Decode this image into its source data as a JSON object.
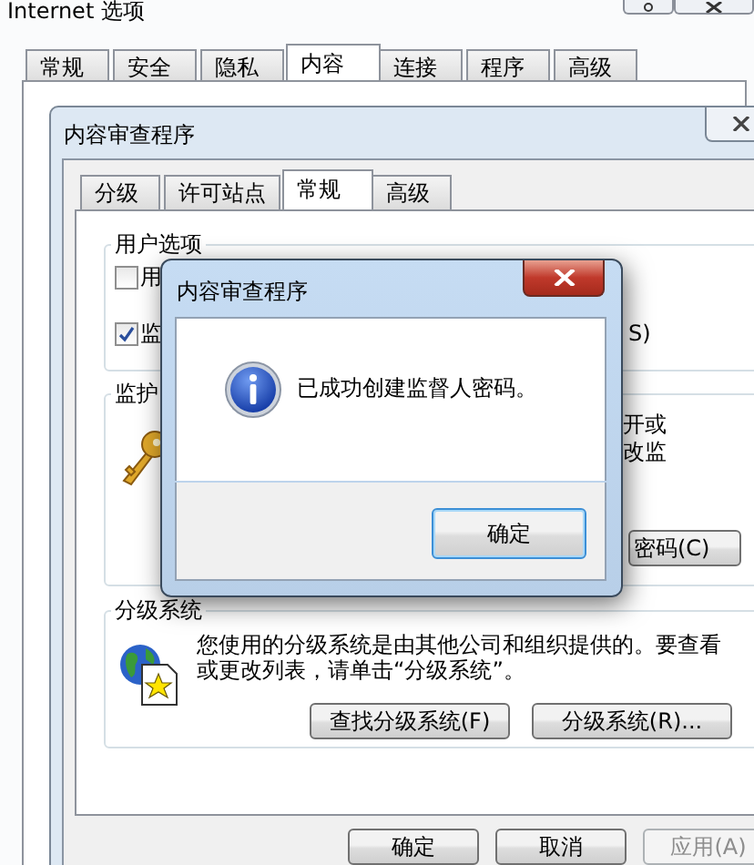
{
  "outer_window": {
    "title": "Internet 选项",
    "tabs": [
      {
        "label": "常规",
        "selected": false
      },
      {
        "label": "安全",
        "selected": false
      },
      {
        "label": "隐私",
        "selected": false
      },
      {
        "label": "内容",
        "selected": true
      },
      {
        "label": "连接",
        "selected": false
      },
      {
        "label": "程序",
        "selected": false
      },
      {
        "label": "高级",
        "selected": false
      }
    ]
  },
  "advisor": {
    "title": "内容审查程序",
    "tabs": [
      {
        "label": "分级",
        "selected": false
      },
      {
        "label": "许可站点",
        "selected": false
      },
      {
        "label": "常规",
        "selected": true
      },
      {
        "label": "高级",
        "selected": false
      }
    ],
    "user_options": {
      "label": "用户选项",
      "options": [
        {
          "label": "用",
          "checked": false
        },
        {
          "label": "监",
          "label_end": "S)",
          "checked": true
        }
      ]
    },
    "supervisor": {
      "label": "监护",
      "text_lines": [
        "开或",
        "改监"
      ],
      "button": "密码(C)"
    },
    "rating_systems": {
      "label": "分级系统",
      "text": "您使用的分级系统是由其他公司和组织提供的。要查看或更改列表，请单击“分级系统”。",
      "buttons": [
        "查找分级系统(F)",
        "分级系统(R)..."
      ]
    },
    "buttons": [
      {
        "label": "确定",
        "disabled": false
      },
      {
        "label": "取消",
        "disabled": false
      },
      {
        "label": "应用(A)",
        "disabled": true
      }
    ]
  },
  "message_box": {
    "title": "内容审查程序",
    "message": "已成功创建监督人密码。",
    "button": "确定"
  }
}
